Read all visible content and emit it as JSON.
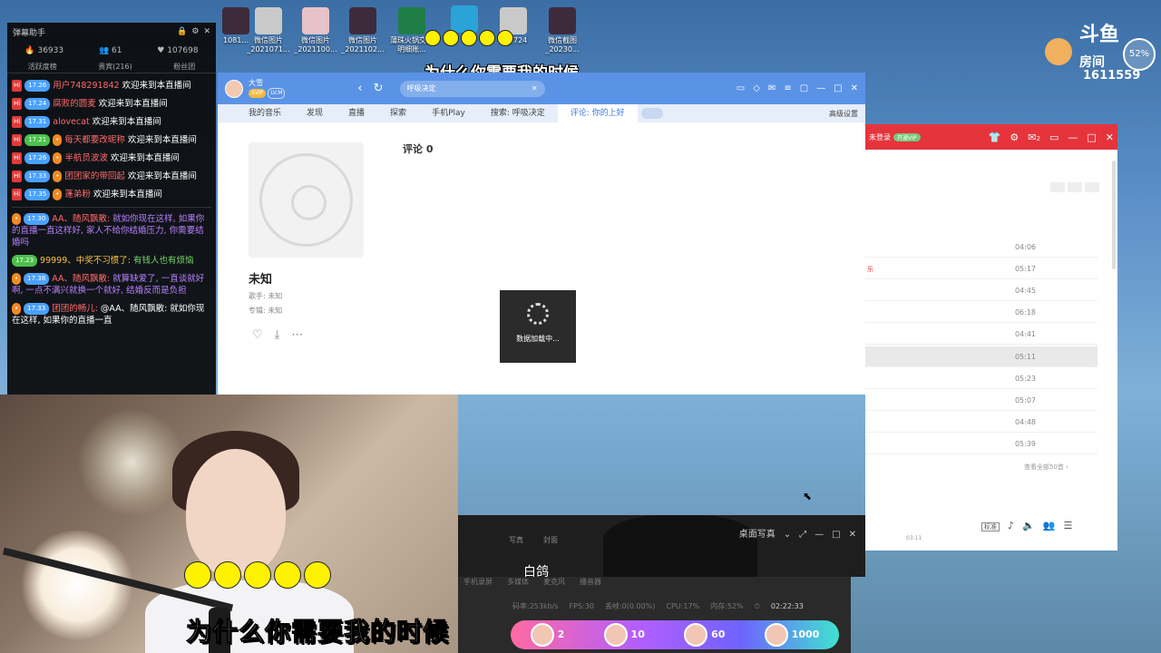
{
  "desktop": {
    "icons": [
      {
        "label": "1081...",
        "color": "dark"
      },
      {
        "label": "微信图片_2021071...",
        "color": "grey"
      },
      {
        "label": "微信图片_2021100...",
        "color": "pink"
      },
      {
        "label": "微信图片_2021102...",
        "color": "dark"
      },
      {
        "label": "蒲珠火锅交出明细账...",
        "color": "green"
      },
      {
        "label": "",
        "color": "cyan"
      },
      {
        "label": "122724",
        "color": "grey"
      },
      {
        "label": "微信截图_20230...",
        "color": "dark"
      }
    ]
  },
  "overlay_subtitle": "为什么你需要我的时候",
  "danmu": {
    "title": "弹幕助手",
    "stats": {
      "heat": "36933",
      "fans": "61",
      "likes": "107698"
    },
    "tabs": [
      "活跃度榜",
      "贵宾(216)",
      "粉丝团"
    ],
    "welcome": [
      {
        "level": "17.26",
        "user": "用户748291842",
        "text": "欢迎来到本直播间"
      },
      {
        "level": "17.24",
        "user": "腐败的圆麦",
        "text": "欢迎来到本直播间"
      },
      {
        "level": "17.31",
        "user": "alovecat",
        "text": "欢迎来到本直播间"
      },
      {
        "level": "17.21",
        "user": "每天都要改昵称",
        "text": "欢迎来到本直播间"
      },
      {
        "level": "17.26",
        "user": "半航员波波",
        "text": "欢迎来到本直播间"
      },
      {
        "level": "17.33",
        "user": "团团家的带回起",
        "text": "欢迎来到本直播间"
      },
      {
        "level": "17.35",
        "user": "蓬弟粉",
        "text": "欢迎来到本直播间"
      }
    ],
    "chat": [
      {
        "level": "17.30",
        "user": "AA、随风飘散:",
        "text": "就如你现在这样, 如果你的直播一直这样好, 家人不给你结婚压力, 你需要结婚吗"
      },
      {
        "level": "17.23",
        "user": "99999、中奖不习惯了:",
        "text": "有钱人也有烦恼"
      },
      {
        "level": "17.38",
        "user": "AA、随风飘散:",
        "text": "就算缺爱了, 一直谈就好啊, 一点不满兴就换一个就好, 结婚反而是负担"
      },
      {
        "level": "17.33",
        "user": "团团的畅儿:",
        "text": "@AA、随风飘散: 就如你现在这样, 如果你的直播一直"
      }
    ]
  },
  "player": {
    "user_name": "大雪",
    "vip": "SVIP",
    "lv": "LV.M",
    "nav": [
      "‹",
      "↻"
    ],
    "search_placeholder": "呼吸决定",
    "tabs": [
      "我的音乐",
      "发现",
      "直播",
      "探索",
      "手机Play",
      "搜索: 呼吸决定",
      "评论: 你的上好"
    ],
    "tab_right": "高级设置",
    "song_title": "未知",
    "singer": "歌手: 未知",
    "album": "专辑: 未知",
    "comment_header": "评论 0",
    "loading": "数据加载中..."
  },
  "right_app": {
    "login": "未登录",
    "vip": "开通VIP",
    "badge": "2",
    "rows": [
      {
        "mark": "",
        "dur": "04:06"
      },
      {
        "mark": "乐",
        "dur": "05:17"
      },
      {
        "mark": "",
        "dur": "04:45"
      },
      {
        "mark": "",
        "dur": "06:18"
      },
      {
        "mark": "",
        "dur": "04:41"
      },
      {
        "mark": "",
        "dur": "05:11"
      },
      {
        "mark": "",
        "dur": "05:23"
      },
      {
        "mark": "",
        "dur": "05:07"
      },
      {
        "mark": "",
        "dur": "04:48"
      },
      {
        "mark": "",
        "dur": "05:39"
      }
    ],
    "see_all": "查看全部50首 ›",
    "standard": "标准",
    "time": "03:11"
  },
  "photo_window": {
    "title": "白鸽",
    "tabs": [
      "写真",
      "封面"
    ],
    "controls": "桌面写真"
  },
  "status": {
    "row1": [
      "手机录屏",
      "多媒体",
      "麦克风",
      "播音器"
    ],
    "bitrate": "码率:253kb/s",
    "fps": "FPS:30",
    "drop": "丢帧:0(0.00%)",
    "cpu": "CPU:17%",
    "mem": "内存:52%",
    "time": "02:22:33",
    "pk": [
      "2",
      "10",
      "60",
      "1000"
    ]
  },
  "douyu": {
    "brand": "斗鱼",
    "room": "房间",
    "room_id": "1611559",
    "percent": "52%"
  }
}
